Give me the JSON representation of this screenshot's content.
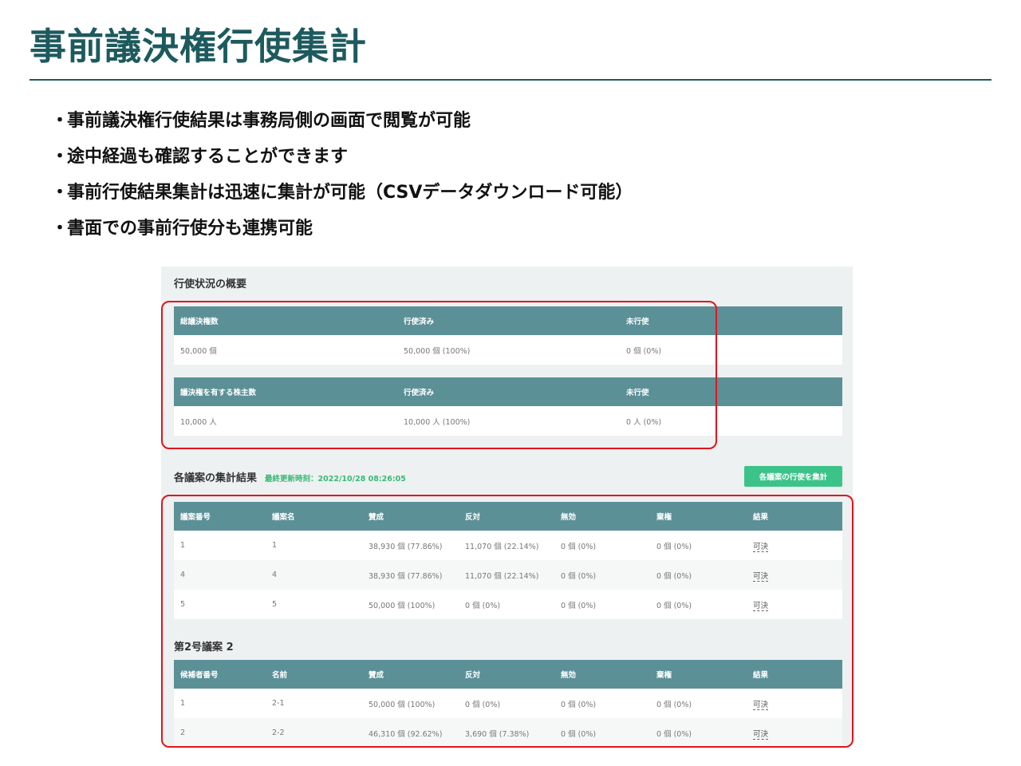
{
  "slide": {
    "title": "事前議決権行使集計",
    "bullet_mark": "・",
    "bullets": [
      "事前議決権行使結果は事務局側の画面で閲覧が可能",
      "途中経過も確認することができます",
      "事前行使結果集計は迅速に集計が可能（CSVデータダウンロード可能）",
      "書面での事前行使分も連携可能"
    ]
  },
  "overview": {
    "title": "行使状況の概要",
    "votes": {
      "headers": [
        "総議決権数",
        "行使済み",
        "未行使"
      ],
      "row": [
        "50,000 個",
        "50,000 個 (100%)",
        "0 個 (0%)"
      ]
    },
    "shareholders": {
      "headers": [
        "議決権を有する株主数",
        "行使済み",
        "未行使"
      ],
      "row": [
        "10,000 人",
        "10,000 人 (100%)",
        "0 人 (0%)"
      ]
    }
  },
  "results": {
    "title": "各議案の集計結果",
    "last_updated": "最終更新時刻：2022/10/28 08:26:05",
    "tally_button": "各議案の行使を集計",
    "proposals": {
      "headers": [
        "議案番号",
        "議案名",
        "賛成",
        "反対",
        "無効",
        "棄権",
        "結果"
      ],
      "rows": [
        [
          "1",
          "1",
          "38,930 個 (77.86%)",
          "11,070 個 (22.14%)",
          "0 個 (0%)",
          "0 個 (0%)",
          "可決"
        ],
        [
          "4",
          "4",
          "38,930 個 (77.86%)",
          "11,070 個 (22.14%)",
          "0 個 (0%)",
          "0 個 (0%)",
          "可決"
        ],
        [
          "5",
          "5",
          "50,000 個 (100%)",
          "0 個 (0%)",
          "0 個 (0%)",
          "0 個 (0%)",
          "可決"
        ]
      ]
    },
    "proposal2": {
      "title": "第2号議案 2",
      "headers": [
        "候補者番号",
        "名前",
        "賛成",
        "反対",
        "無効",
        "棄権",
        "結果"
      ],
      "rows": [
        [
          "1",
          "2-1",
          "50,000 個 (100%)",
          "0 個 (0%)",
          "0 個 (0%)",
          "0 個 (0%)",
          "可決"
        ],
        [
          "2",
          "2-2",
          "46,310 個 (92.62%)",
          "3,690 個 (7.38%)",
          "0 個 (0%)",
          "0 個 (0%)",
          "可決"
        ]
      ]
    }
  },
  "colors": {
    "title": "#1d5a5e",
    "table_header": "#5b9097",
    "accent_green": "#3cc38a",
    "highlight_red": "#e0141e"
  }
}
